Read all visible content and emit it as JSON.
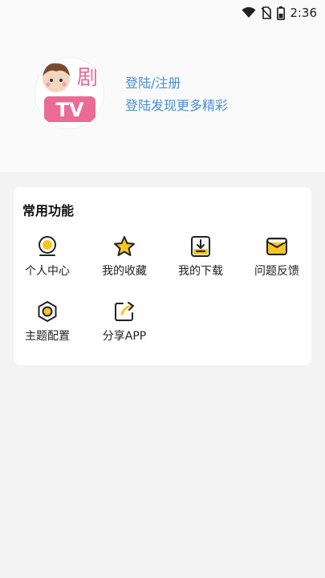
{
  "status_bar": {
    "time": "2:36",
    "icons": [
      "wifi-icon",
      "no-sim-icon",
      "battery-icon"
    ]
  },
  "profile": {
    "logo_text": "剧",
    "logo_badge": "TV",
    "login_label": "登陆/注册",
    "login_subtitle": "登陆发现更多精彩"
  },
  "functions": {
    "title": "常用功能",
    "items": [
      {
        "label": "个人中心",
        "icon": "user-center-icon"
      },
      {
        "label": "我的收藏",
        "icon": "star-icon"
      },
      {
        "label": "我的下载",
        "icon": "download-icon"
      },
      {
        "label": "问题反馈",
        "icon": "mail-icon"
      },
      {
        "label": "主题配置",
        "icon": "theme-icon"
      },
      {
        "label": "分享APP",
        "icon": "share-icon"
      }
    ]
  },
  "colors": {
    "accent_yellow": "#f7c623",
    "link_blue": "#4a8fd4",
    "badge_pink": "#ec6a96"
  }
}
